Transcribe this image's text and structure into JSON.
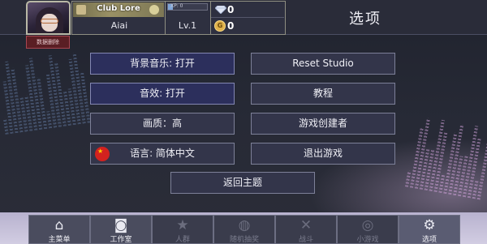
{
  "profile": {
    "club_name": "Club Lore",
    "player_name": "Aiai",
    "xp_text": "XP: 0",
    "xp_progress": 0.12,
    "level": "Lv.1",
    "delete_label": "数据删除"
  },
  "currency": {
    "diamonds": "0",
    "coins": "0",
    "coin_glyph": "G",
    "diamond_icon": "diamond-icon",
    "coin_icon": "coin-icon"
  },
  "page_title": "选项",
  "menu": {
    "bgm": "背景音乐: 打开",
    "reset": "Reset Studio",
    "sfx": "音效: 打开",
    "tutorial": "教程",
    "quality": "画质：高",
    "creators": "游戏创建者",
    "language": "语言: 简体中文",
    "exit": "退出游戏",
    "home": "返回主题"
  },
  "nav": [
    {
      "label": "主菜单",
      "icon": "home-icon",
      "glyph": "⌂",
      "state": "normal"
    },
    {
      "label": "工作室",
      "icon": "camera-icon",
      "glyph": "◙",
      "state": "normal"
    },
    {
      "label": "人群",
      "icon": "star-icon",
      "glyph": "★",
      "state": "dim"
    },
    {
      "label": "随机抽奖",
      "icon": "ball-icon",
      "glyph": "◍",
      "state": "dim"
    },
    {
      "label": "战斗",
      "icon": "swords-icon",
      "glyph": "✕",
      "state": "dim"
    },
    {
      "label": "小游戏",
      "icon": "gamepad-icon",
      "glyph": "◎",
      "state": "dim"
    },
    {
      "label": "选项",
      "icon": "gear-icon",
      "glyph": "⚙",
      "state": "active"
    }
  ],
  "colors": {
    "accent_button": "#2c2f5c",
    "delete_button": "#5a1e24",
    "flag_red": "#d3221f"
  }
}
